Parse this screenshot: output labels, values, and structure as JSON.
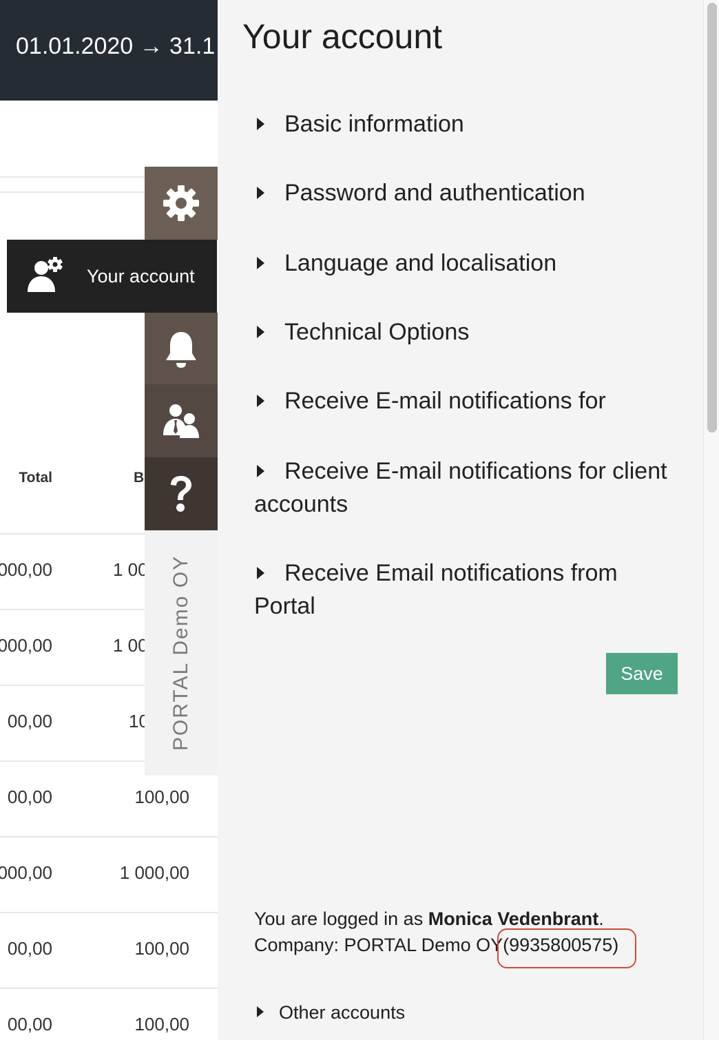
{
  "topbar": {
    "date_range": "01.01.2020 → 31.1"
  },
  "table": {
    "headers": [
      "Total",
      "B"
    ],
    "rows": [
      [
        "000,00",
        "1 00"
      ],
      [
        "000,00",
        "1 00"
      ],
      [
        "00,00",
        "10"
      ],
      [
        "00,00",
        "100,00"
      ],
      [
        "000,00",
        "1 000,00"
      ],
      [
        "00,00",
        "100,00"
      ],
      [
        "00,00",
        "100,00"
      ]
    ]
  },
  "nav": {
    "tooltip_label": "Your account",
    "company_vertical": "PORTAL Demo OY",
    "icons": [
      "gear-icon",
      "user-gear-icon",
      "bell-icon",
      "people-icon",
      "question-icon"
    ]
  },
  "panel": {
    "title": "Your account",
    "sections": [
      "Basic information",
      "Password and authentication",
      "Language and localisation",
      "Technical Options",
      "Receive E-mail notifications for",
      "Receive E-mail notifications for client accounts",
      "Receive Email notifications from Portal"
    ],
    "save_label": "Save",
    "login": {
      "prefix": "You are logged in as ",
      "user": "Monica Vedenbrant",
      "suffix": ".",
      "company_prefix": "Company: PORTAL Demo OY",
      "company_id": "(9935800575)"
    },
    "other_accounts": "Other accounts"
  },
  "colors": {
    "save": "#4fa584",
    "topbar": "#262c33",
    "highlight": "#d04a3a"
  }
}
